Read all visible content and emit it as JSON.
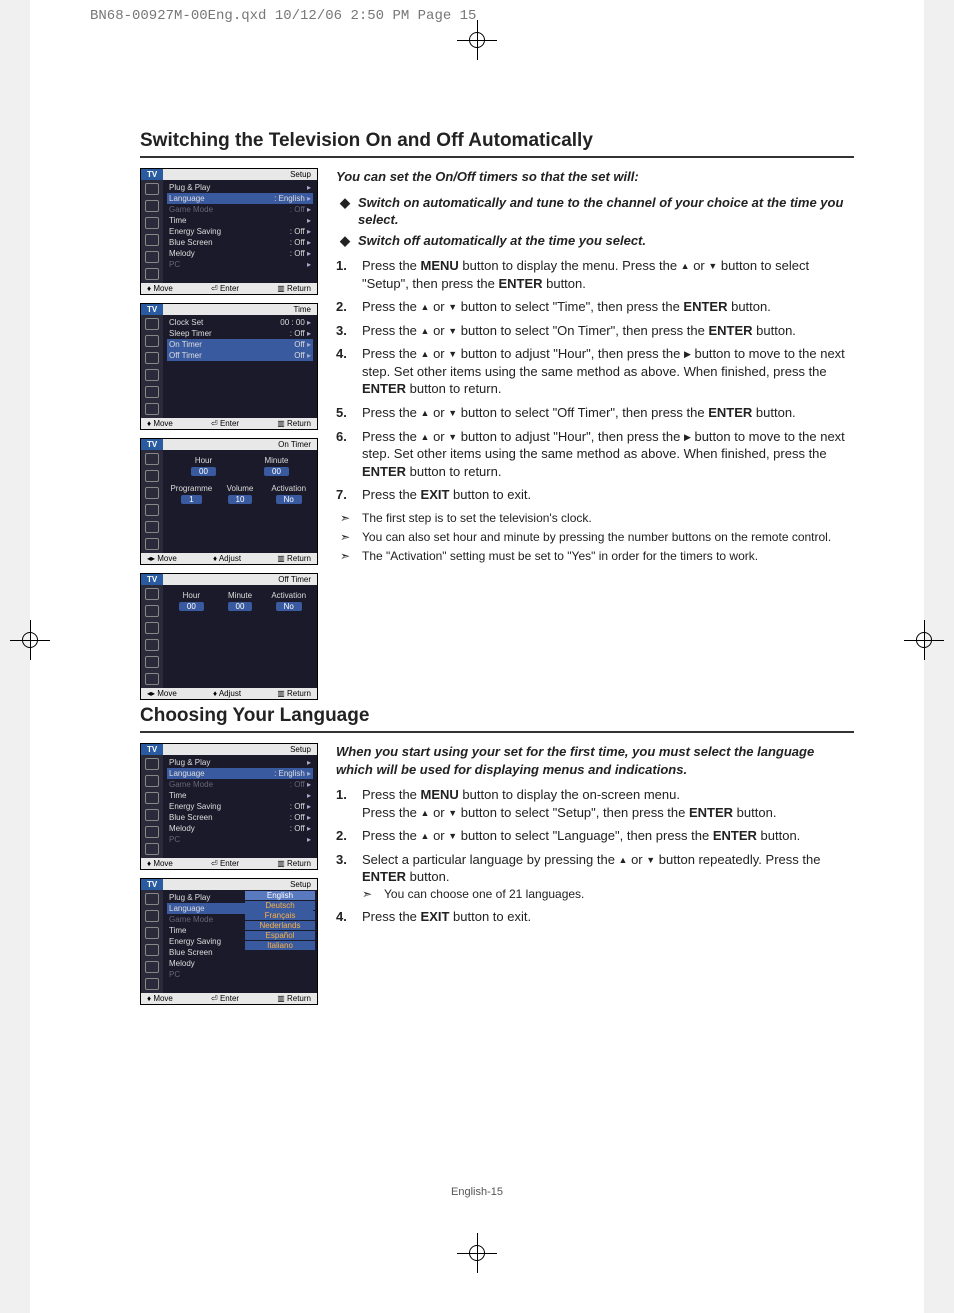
{
  "print_header": "BN68-00927M-00Eng.qxd  10/12/06  2:50 PM  Page 15",
  "footer": "English-15",
  "section1": {
    "title": "Switching the Television On and Off Automatically",
    "intro": "You can set the On/Off timers so that the set will:",
    "bullets": [
      "Switch on automatically and tune to the channel of your choice at the time you select.",
      "Switch off automatically at the time you select."
    ],
    "steps": [
      {
        "n": "1.",
        "t": "Press the <b>MENU</b> button to display the menu. Press the <span class='tri-up'>▲</span> or <span class='tri-dn'>▼</span> button to select \"Setup\", then press the <b>ENTER</b> button."
      },
      {
        "n": "2.",
        "t": "Press the <span class='tri-up'>▲</span> or <span class='tri-dn'>▼</span> button to select \"Time\", then press the <b>ENTER</b> button."
      },
      {
        "n": "3.",
        "t": "Press the <span class='tri-up'>▲</span> or <span class='tri-dn'>▼</span> button to select \"On Timer\", then press the <b>ENTER</b> button."
      },
      {
        "n": "4.",
        "t": "Press the <span class='tri-up'>▲</span> or <span class='tri-dn'>▼</span> button to adjust \"Hour\", then press the <span class='tri-r'>▶</span> button to move to the next step. Set other items using the same method as above. When finished, press the <b>ENTER</b> button to return."
      },
      {
        "n": "5.",
        "t": "Press the <span class='tri-up'>▲</span> or <span class='tri-dn'>▼</span> button to select \"Off Timer\", then press the <b>ENTER</b> button."
      },
      {
        "n": "6.",
        "t": "Press the <span class='tri-up'>▲</span> or <span class='tri-dn'>▼</span> button to adjust \"Hour\", then press the <span class='tri-r'>▶</span> button to move to the next step. Set other items using the same method as above. When finished, press the <b>ENTER</b> button to return."
      },
      {
        "n": "7.",
        "t": "Press the <b>EXIT</b> button to exit."
      }
    ],
    "notes": [
      "The first step is to set the television's clock.",
      "You can also set hour and minute by pressing the number buttons on the remote control.",
      "The \"Activation\" setting must be set to \"Yes\" in order for the timers to work."
    ]
  },
  "section2": {
    "title": "Choosing Your Language",
    "intro": "When you start using your set for the first time, you must select the language which will be used for displaying menus and indications.",
    "steps": [
      {
        "n": "1.",
        "t": "Press the <b>MENU</b> button to display the on-screen menu.<br>Press the <span class='tri-up'>▲</span> or <span class='tri-dn'>▼</span> button to select \"Setup\", then press the <b>ENTER</b> button."
      },
      {
        "n": "2.",
        "t": "Press the <span class='tri-up'>▲</span> or <span class='tri-dn'>▼</span> button to select \"Language\", then press the <b>ENTER</b> button."
      },
      {
        "n": "3.",
        "t": "Select a particular language by pressing the <span class='tri-up'>▲</span> or <span class='tri-dn'>▼</span> button repeatedly. Press the <b>ENTER</b> button.<div class='inline-note' data-name='inline-note' data-interactable='false'>You can choose one of 21 languages.</div>"
      },
      {
        "n": "4.",
        "t": "Press the <b>EXIT</b> button to exit."
      }
    ]
  },
  "osd": {
    "tv": "TV",
    "setup": "Setup",
    "time": "Time",
    "ontimer": "On Timer",
    "offtimer": "Off Timer",
    "move": "Move",
    "enter": "Enter",
    "return": "Return",
    "adjust": "Adjust",
    "setup_items": [
      {
        "l": "Plug & Play",
        "v": "",
        "cls": ""
      },
      {
        "l": "Language",
        "v": ": English",
        "cls": "sel"
      },
      {
        "l": "Game Mode",
        "v": ": Off",
        "cls": "dim"
      },
      {
        "l": "Time",
        "v": "",
        "cls": ""
      },
      {
        "l": "Energy Saving",
        "v": ": Off",
        "cls": ""
      },
      {
        "l": "Blue Screen",
        "v": ": Off",
        "cls": ""
      },
      {
        "l": "Melody",
        "v": ": Off",
        "cls": ""
      },
      {
        "l": "PC",
        "v": "",
        "cls": "dim"
      }
    ],
    "time_items": [
      {
        "l": "Clock Set",
        "v": "00 : 00",
        "cls": ""
      },
      {
        "l": "Sleep Timer",
        "v": ": Off",
        "cls": ""
      },
      {
        "l": "On Timer",
        "v": "Off",
        "cls": "sel"
      },
      {
        "l": "Off Timer",
        "v": "Off",
        "cls": "sel"
      }
    ],
    "ontimer_cols1": [
      "Hour",
      "Minute"
    ],
    "ontimer_vals1": [
      "00",
      "00"
    ],
    "ontimer_cols2": [
      "Programme",
      "Volume",
      "Activation"
    ],
    "ontimer_vals2": [
      "1",
      "10",
      "No"
    ],
    "offtimer_cols": [
      "Hour",
      "Minute",
      "Activation"
    ],
    "offtimer_vals": [
      "00",
      "00",
      "No"
    ],
    "langs": [
      "English",
      "Deutsch",
      "Français",
      "Nederlands",
      "Español",
      "Italiano"
    ]
  }
}
